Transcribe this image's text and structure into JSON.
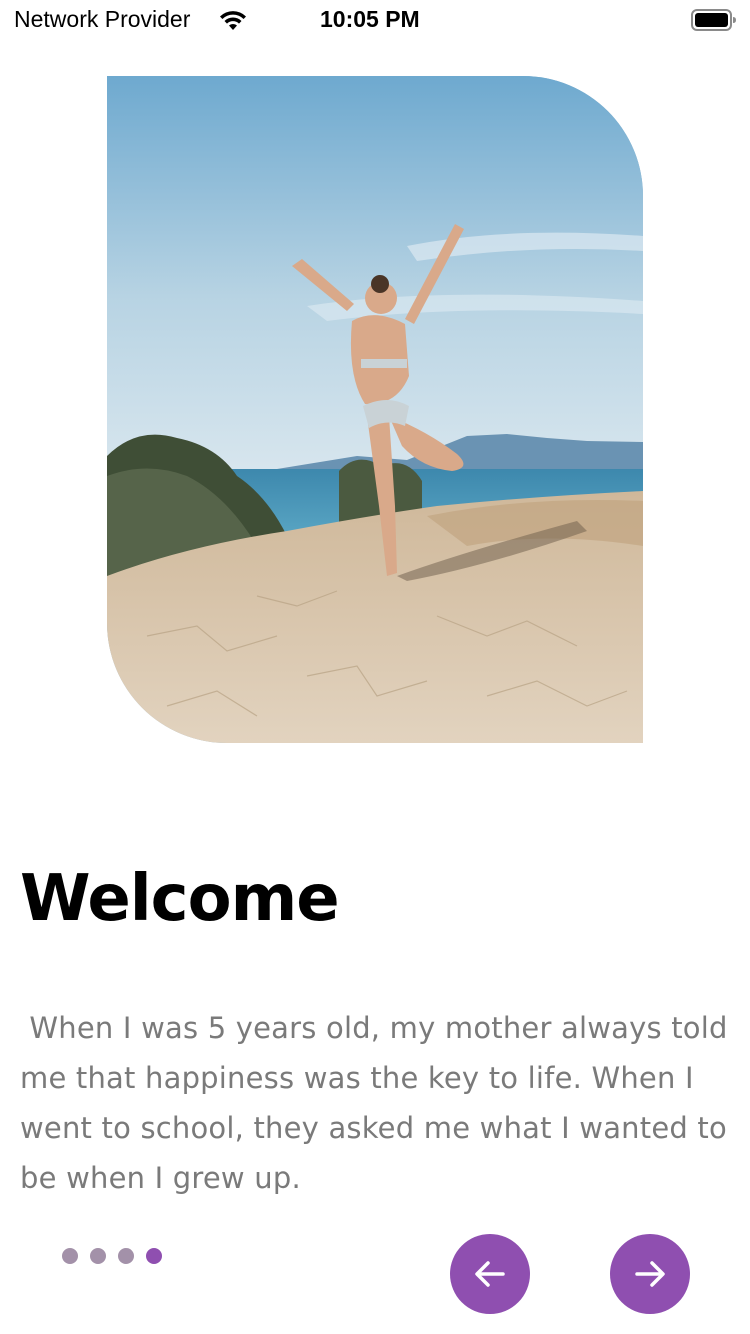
{
  "status_bar": {
    "carrier": "Network Provider",
    "time": "10:05 PM",
    "wifi_icon": "wifi-icon",
    "battery_icon": "battery-full-icon"
  },
  "hero_image": {
    "alt": "Woman in yoga tree pose on a sandy cliff by the sea"
  },
  "onboarding": {
    "title": "Welcome",
    "description": " When I was 5 years old, my mother always told me that happiness was the key to life. When I went to school, they asked me what I wanted to be when I grew up."
  },
  "pager": {
    "total": 4,
    "active_index": 3
  },
  "navigation": {
    "prev_icon": "arrow-left-icon",
    "next_icon": "arrow-right-icon"
  },
  "colors": {
    "accent": "#8f4fb0",
    "dot_inactive": "#a391a9",
    "body_text": "#7a7a7a"
  }
}
